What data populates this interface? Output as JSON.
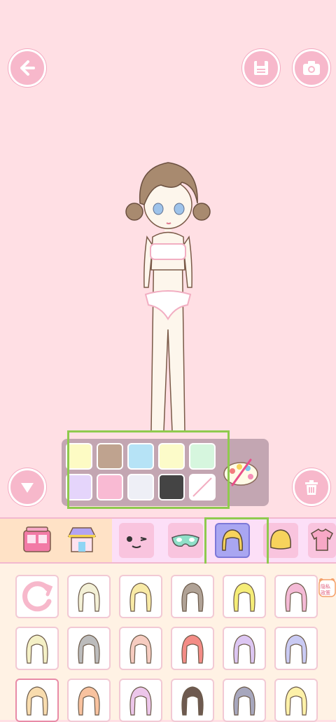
{
  "palette": {
    "swatches": [
      "#fdfbc4",
      "#bfa38f",
      "#b6e3f6",
      "#fcfbc9",
      "#d6f6de",
      "#e5d5fb",
      "#f9bad3",
      "#eeeff6",
      "#444444",
      "none"
    ]
  },
  "badge": {
    "line1": "隐私",
    "line2": "政策"
  },
  "tabs": [
    "shop",
    "shop2",
    "face",
    "mask",
    "hair-front",
    "hair-back",
    "shirt"
  ],
  "hair_items": [
    {
      "color": "#f3f0d6"
    },
    {
      "color": "#f8eaa6"
    },
    {
      "color": "#b0a296"
    },
    {
      "color": "#f5ed77"
    },
    {
      "color": "#f4bad6"
    },
    {
      "color": "#f4f0c6"
    },
    {
      "color": "#bcbcbc"
    },
    {
      "color": "#f6ccc0"
    },
    {
      "color": "#f38c86"
    },
    {
      "color": "#dcc6f2"
    },
    {
      "color": "#c9caf3"
    },
    {
      "color": "#f8dcae"
    },
    {
      "color": "#f8c29f"
    },
    {
      "color": "#ecc6ea"
    },
    {
      "color": "#6e5a50"
    },
    {
      "color": "#a7a7bd"
    },
    {
      "color": "#fdf1a9"
    }
  ]
}
